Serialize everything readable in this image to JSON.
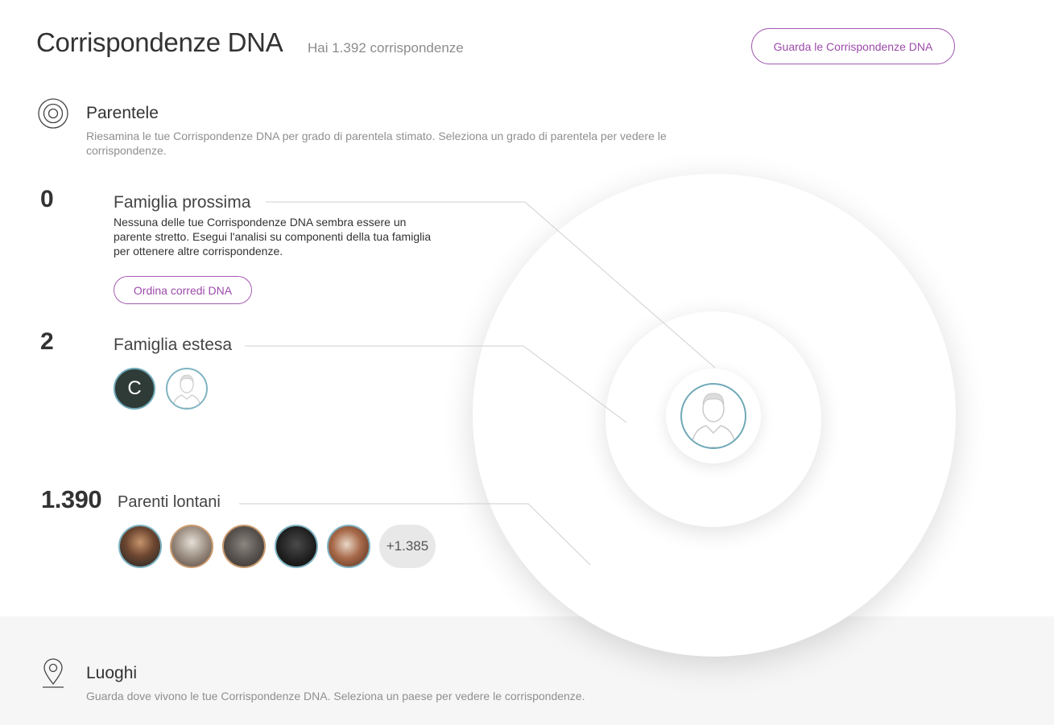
{
  "header": {
    "title": "Corrispondenze DNA",
    "match_count": "Hai 1.392 corrispondenze",
    "view_button": "Guarda le Corrispondenze DNA"
  },
  "relationships": {
    "icon": "target-icon",
    "title": "Parentele",
    "description": "Riesamina le tue Corrispondenze DNA per grado di parentela stimato. Seleziona un grado di parentela per vedere le corrispondenze."
  },
  "groups": {
    "close": {
      "count": "0",
      "title": "Famiglia prossima",
      "description": "Nessuna delle tue Corrispondenze DNA sembra essere un parente stretto. Esegui l'analisi su componenti della tua famiglia per ottenere altre corrispondenze.",
      "button": "Ordina corredi DNA"
    },
    "extended": {
      "count": "2",
      "title": "Famiglia estesa",
      "avatar_letter": "C"
    },
    "distant": {
      "count": "1.390",
      "title": "Parenti lontani",
      "more": "+1.385"
    }
  },
  "places": {
    "icon": "location-pin-icon",
    "title": "Luoghi",
    "description": "Guarda dove vivono le tue Corrispondenze DNA. Seleziona un paese per vedere le corrispondenze."
  },
  "colors": {
    "accent": "#9c4aaa",
    "avatar_border": "#6fa9b8",
    "band": "#f6f6f6"
  }
}
